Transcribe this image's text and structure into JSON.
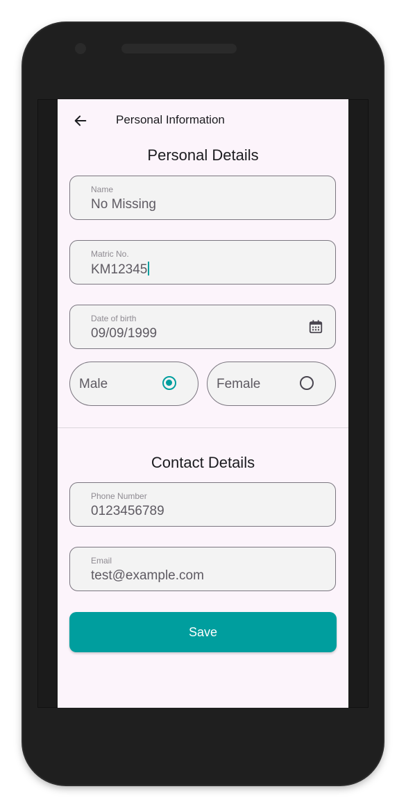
{
  "appbar": {
    "title": "Personal Information",
    "back_icon": "arrow-left-icon"
  },
  "personal": {
    "title": "Personal Details",
    "name": {
      "label": "Name",
      "value": "No Missing"
    },
    "matric": {
      "label": "Matric No.",
      "value": "KM12345"
    },
    "dob": {
      "label": "Date of birth",
      "value": "09/09/1999",
      "icon": "calendar-icon"
    },
    "gender": {
      "male": {
        "label": "Male",
        "selected": true
      },
      "female": {
        "label": "Female",
        "selected": false
      }
    }
  },
  "contact": {
    "title": "Contact Details",
    "phone": {
      "label": "Phone Number",
      "value": "0123456789"
    },
    "email": {
      "label": "Email",
      "value": "test@example.com"
    }
  },
  "save_label": "Save",
  "colors": {
    "accent": "#009e9e",
    "background": "#fcf4fb",
    "field_bg": "#f3f3f3",
    "field_border": "#7a757f"
  }
}
